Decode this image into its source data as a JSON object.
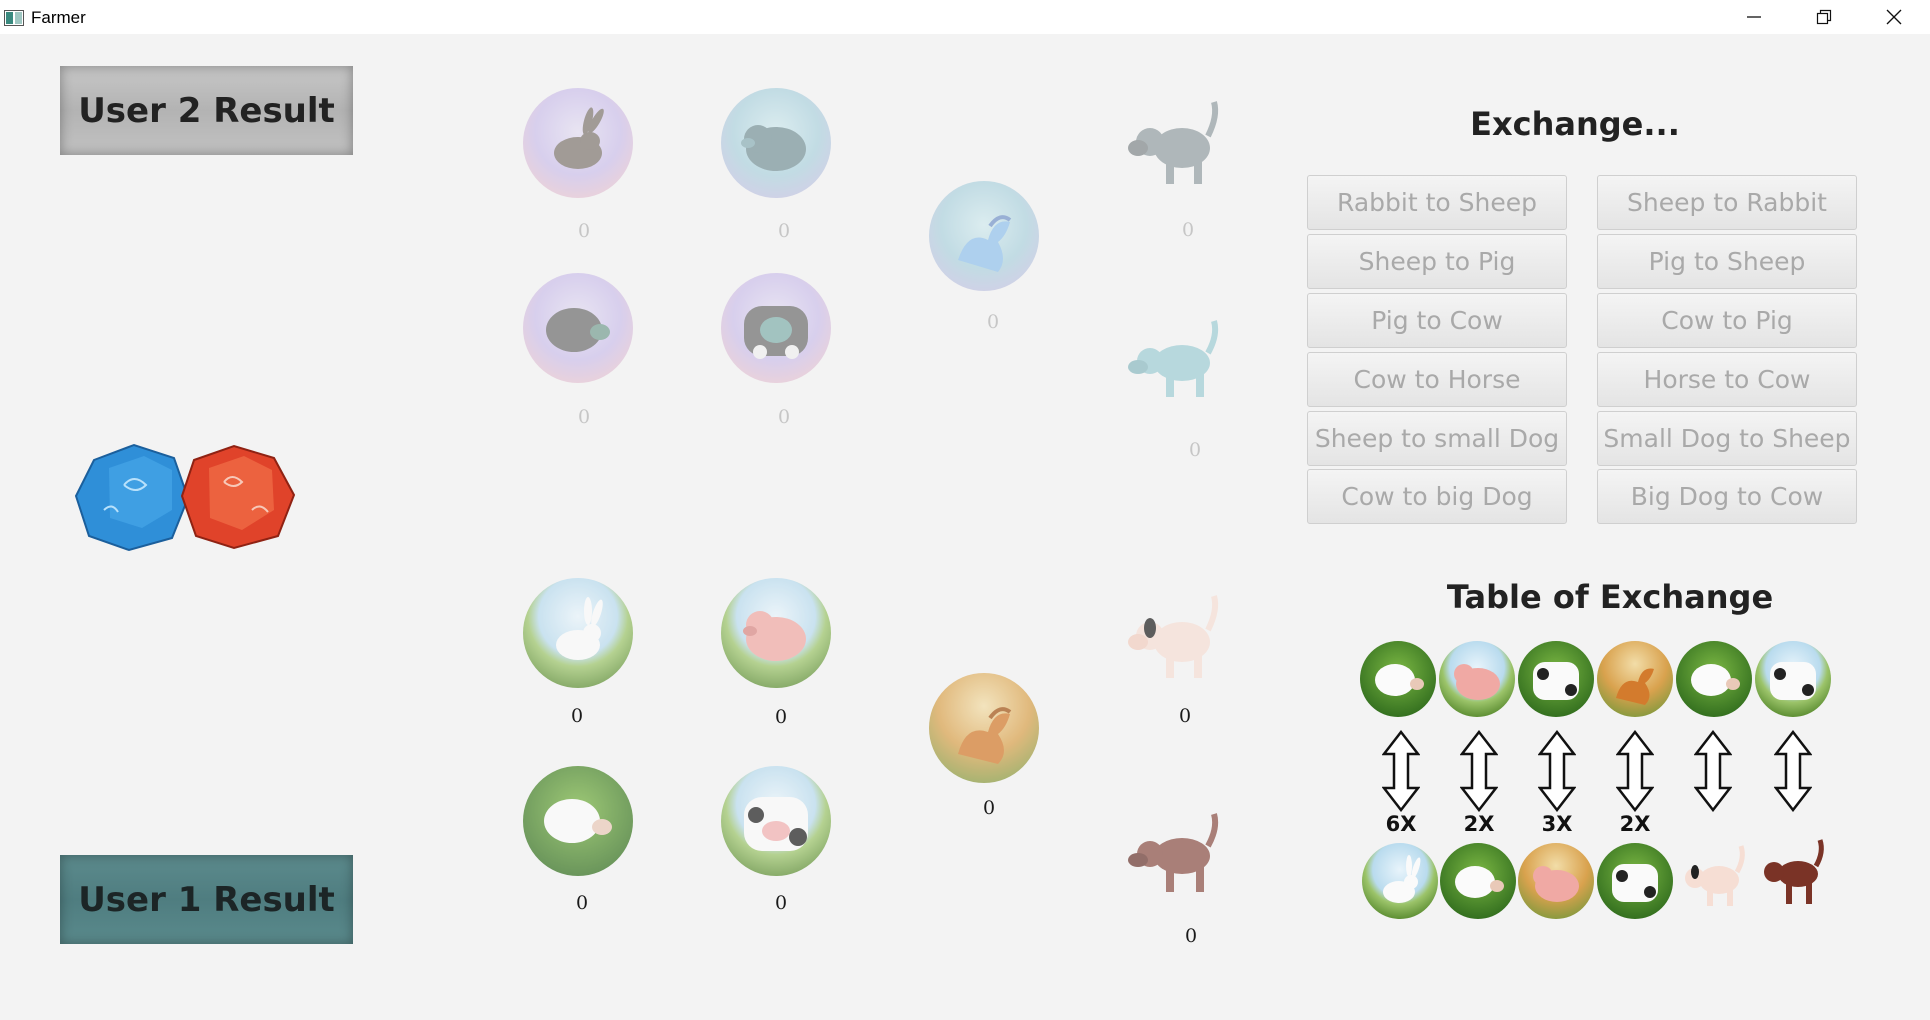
{
  "window": {
    "title": "Farmer",
    "controls": {
      "minimize": "minimize-icon",
      "maximize": "restore-icon",
      "close": "close-icon"
    }
  },
  "players": {
    "user2_label": "User 2 Result",
    "user1_label": "User 1 Result"
  },
  "dice": {
    "icon": "dice-icon",
    "colors": [
      "#2f8fd8",
      "#e0432a"
    ]
  },
  "user2_animals": {
    "rabbit": "0",
    "sheep": "0",
    "pig": "0",
    "cow": "0",
    "horse": "0",
    "small_dog": "0",
    "big_dog": "0"
  },
  "user1_animals": {
    "rabbit": "0",
    "sheep": "0",
    "pig": "0",
    "cow": "0",
    "horse": "0",
    "small_dog": "0",
    "big_dog": "0"
  },
  "exchange": {
    "title": "Exchange...",
    "buttons": [
      "Rabbit to Sheep",
      "Sheep to Rabbit",
      "Sheep to Pig",
      "Pig to Sheep",
      "Pig to Cow",
      "Cow to Pig",
      "Cow to Horse",
      "Horse to Cow",
      "Sheep to small Dog",
      "Small Dog to Sheep",
      "Cow to big Dog",
      "Big Dog to Cow"
    ]
  },
  "table_of_exchange": {
    "title": "Table of Exchange",
    "multipliers": [
      "6X",
      "2X",
      "3X",
      "2X"
    ],
    "top_animals": [
      "sheep-icon",
      "pig-icon",
      "cow-icon",
      "horse-icon",
      "sheep-icon",
      "cow-icon"
    ],
    "bottom_animals": [
      "rabbit-icon",
      "sheep-icon",
      "pig-icon",
      "cow-icon",
      "small-dog-icon",
      "big-dog-icon"
    ]
  }
}
